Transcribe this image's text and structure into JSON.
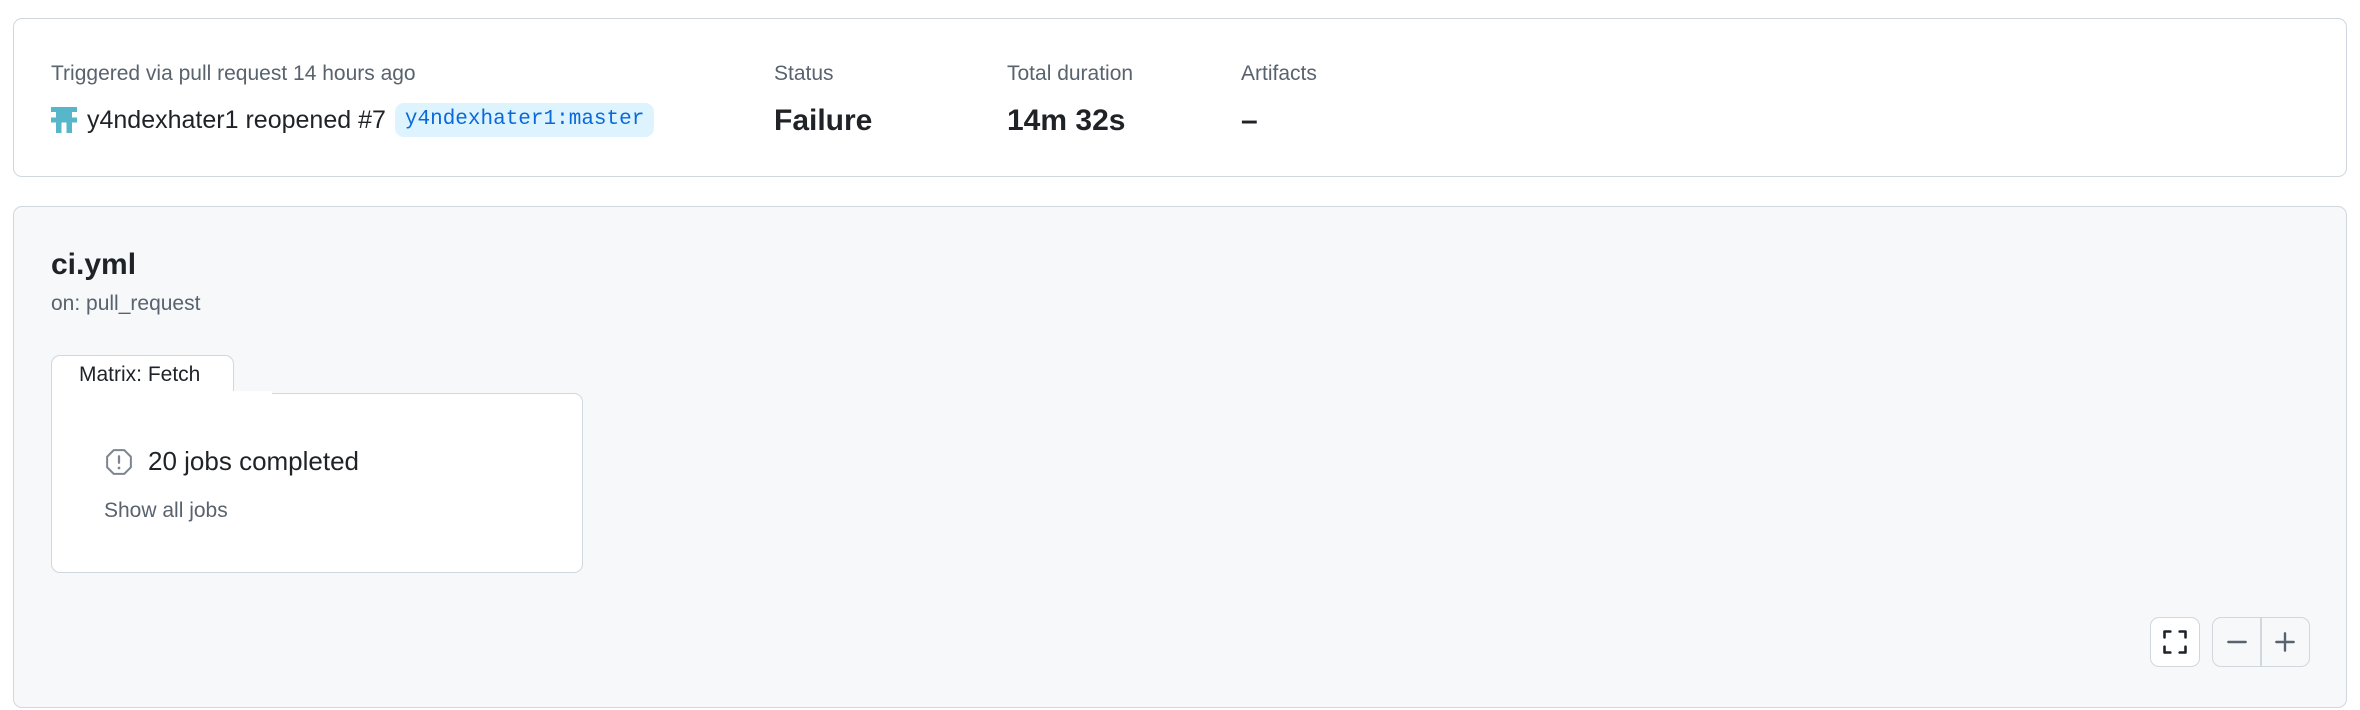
{
  "summary": {
    "trigger_label": "Triggered via pull request 14 hours ago",
    "actor": "y4ndexhater1",
    "action": "reopened",
    "pr_number": "#7",
    "branch": "y4ndexhater1:master",
    "status_label": "Status",
    "status_value": "Failure",
    "duration_label": "Total duration",
    "duration_value": "14m 32s",
    "artifacts_label": "Artifacts",
    "artifacts_value": "–"
  },
  "workflow": {
    "file": "ci.yml",
    "event": "on: pull_request",
    "matrix": {
      "tab_label": "Matrix: Fetch",
      "jobs_summary": "20 jobs completed",
      "show_all_label": "Show all jobs"
    }
  },
  "icons": {
    "avatar": "identicon-avatar",
    "jobs_status": "alert-octagon-icon",
    "fullscreen": "fullscreen-icon",
    "zoom_out": "minus-icon",
    "zoom_in": "plus-icon"
  },
  "colors": {
    "accent_link": "#0969da",
    "branch_bg": "#ddf4ff",
    "avatar": "#57b6c9",
    "muted": "#59636e"
  }
}
